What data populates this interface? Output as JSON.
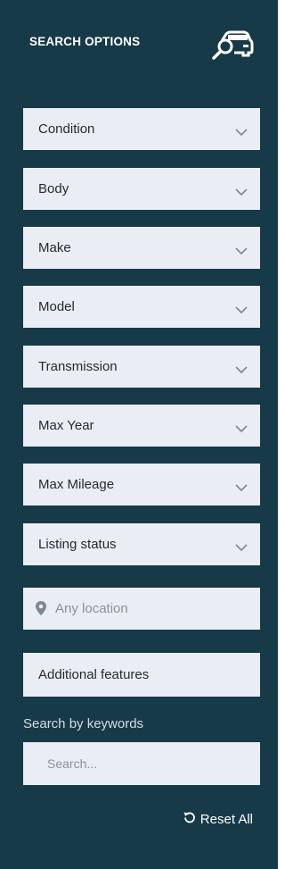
{
  "header": {
    "title": "SEARCH OPTIONS",
    "icon": "car-search-icon"
  },
  "filters": [
    {
      "label": "Condition"
    },
    {
      "label": "Body"
    },
    {
      "label": "Make"
    },
    {
      "label": "Model"
    },
    {
      "label": "Transmission"
    },
    {
      "label": "Max Year"
    },
    {
      "label": "Max Mileage"
    },
    {
      "label": "Listing status"
    }
  ],
  "location": {
    "placeholder": "Any location",
    "icon": "location-pin-icon"
  },
  "features": {
    "label": "Additional features"
  },
  "keywords": {
    "label": "Search by keywords",
    "placeholder": "Search..."
  },
  "reset": {
    "label": "Reset All",
    "icon": "reset-icon"
  },
  "colors": {
    "panel": "#173a48",
    "field": "#eaedf3",
    "text": "#1f2a35"
  }
}
